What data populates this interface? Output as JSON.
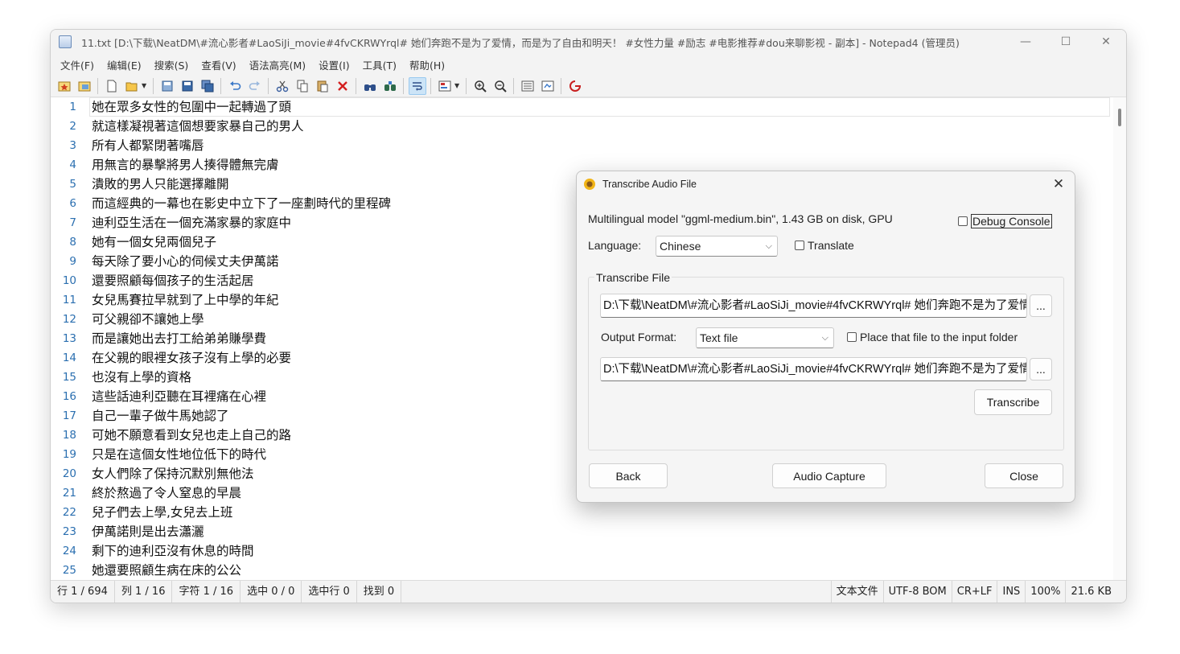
{
  "window": {
    "title": "11.txt [D:\\下载\\NeatDM\\#流心影者#LaoSiJi_movie#4fvCKRWYrql# 她们奔跑不是为了爱情，而是为了自由和明天！ #女性力量 #励志 #电影推荐#dou来聊影视 - 副本] - Notepad4 (管理员)",
    "minimize": "—",
    "maximize": "☐",
    "close": "✕"
  },
  "menu": [
    "文件(F)",
    "编辑(E)",
    "搜索(S)",
    "查看(V)",
    "语法高亮(M)",
    "设置(I)",
    "工具(T)",
    "帮助(H)"
  ],
  "editor": {
    "lines": [
      "她在眾多女性的包圍中一起轉過了頭",
      "就這樣凝視著這個想要家暴自己的男人",
      "所有人都緊閉著嘴唇",
      "用無言的暴擊將男人揍得體無完膚",
      "潰敗的男人只能選擇離開",
      "而這經典的一幕也在影史中立下了一座劃時代的里程碑",
      "迪利亞生活在一個充滿家暴的家庭中",
      "她有一個女兒兩個兒子",
      "每天除了要小心的伺候丈夫伊萬諾",
      "還要照顧每個孩子的生活起居",
      "女兒馬賽拉早就到了上中學的年紀",
      "可父親卻不讓她上學",
      "而是讓她出去打工給弟弟賺學費",
      "在父親的眼裡女孩子沒有上學的必要",
      "也沒有上學的資格",
      "這些話迪利亞聽在耳裡痛在心裡",
      "自己一輩子做牛馬她認了",
      "可她不願意看到女兒也走上自己的路",
      "只是在這個女性地位低下的時代",
      "女人們除了保持沉默別無他法",
      "終於熬過了令人窒息的早晨",
      "兒子們去上學,女兒去上班",
      "伊萬諾則是出去瀟灑",
      "剩下的迪利亞沒有休息的時間",
      "她還要照顧生病在床的公公"
    ],
    "line_numbers": [
      "1",
      "2",
      "3",
      "4",
      "5",
      "6",
      "7",
      "8",
      "9",
      "10",
      "11",
      "12",
      "13",
      "14",
      "15",
      "16",
      "17",
      "18",
      "19",
      "20",
      "21",
      "22",
      "23",
      "24",
      "25"
    ]
  },
  "status": {
    "line": "行 1 / 694",
    "col": "列 1 / 16",
    "char": "字符 1 / 16",
    "sel": "选中 0 / 0",
    "sel_lines": "选中行 0",
    "found": "找到 0",
    "lexer": "文本文件",
    "encoding": "UTF-8 BOM",
    "eol": "CR+LF",
    "ovr": "INS",
    "zoom": "100%",
    "size": "21.6 KB"
  },
  "dialog": {
    "title": "Transcribe Audio File",
    "model_info": "Multilingual model \"ggml-medium.bin\", 1.43 GB on disk, GPU",
    "debug_console": "Debug Console",
    "language_label": "Language:",
    "language_value": "Chinese",
    "translate": "Translate",
    "group_title": "Transcribe File",
    "input_path": "D:\\下载\\NeatDM\\#流心影者#LaoSiJi_movie#4fvCKRWYrql# 她们奔跑不是为了爱情，而是为了自由和明天！",
    "browse": "...",
    "output_format_label": "Output Format:",
    "output_format_value": "Text file",
    "place_in_input_folder": "Place that file to the input folder",
    "output_path": "D:\\下载\\NeatDM\\#流心影者#LaoSiJi_movie#4fvCKRWYrql# 她们奔跑不是为了爱情，而是为了自由和明天！",
    "transcribe": "Transcribe",
    "back": "Back",
    "audio_capture": "Audio Capture",
    "close": "Close",
    "close_x": "✕"
  },
  "colors": {
    "line_number": "#2b6fb0",
    "chrome": "#f3f3f3",
    "dialog_bg": "#f5f5f5"
  }
}
